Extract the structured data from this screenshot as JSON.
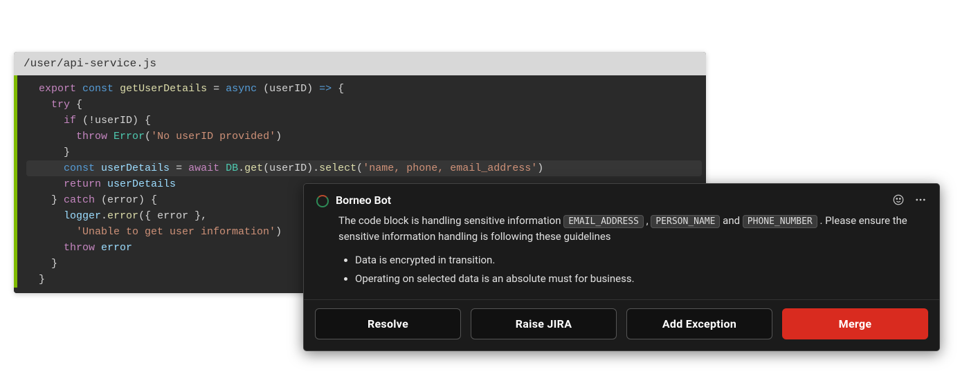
{
  "file_path": "/user/api-service.js",
  "code": {
    "l1": {
      "kw_export": "export",
      "kw_const": "const",
      "fn": "getUserDetails",
      "eq": " = ",
      "kw_async": "async",
      "params": " (userID) ",
      "arrow": "=>",
      "brace": " {"
    },
    "l2": {
      "kw_try": "try",
      "brace": " {"
    },
    "l3": {
      "kw_if": "if",
      "cond": " (!userID) {"
    },
    "l4": {
      "kw_throw": "throw",
      "cls": " Error",
      "open": "(",
      "str": "'No userID provided'",
      "close": ")"
    },
    "l5": {
      "brace": "}"
    },
    "l6": {
      "kw_const": "const",
      "ident": " userDetails",
      "eq": " = ",
      "kw_await": "await",
      "cls": " DB",
      "dot1": ".",
      "m1": "get",
      "p1": "(userID).",
      "m2": "select",
      "p2": "(",
      "str": "'name, phone, email_address'",
      "p3": ")"
    },
    "l7": {
      "kw_return": "return",
      "ident": " userDetails"
    },
    "l8": {
      "brace": "} ",
      "kw_catch": "catch",
      "params": " (error) {"
    },
    "l9": {
      "obj": "logger",
      "dot": ".",
      "m": "error",
      "args": "({ error },"
    },
    "l10": {
      "str": "'Unable to get user information'",
      "close": ")"
    },
    "l11": {
      "kw_throw": "throw",
      "ident": " error"
    },
    "l12": {
      "brace": "}"
    },
    "l13": {
      "brace": "}"
    }
  },
  "bot": {
    "name": "Borneo Bot",
    "msg_prefix": "The code block is handling sensitive information ",
    "chips": {
      "c1": "EMAIL_ADDRESS",
      "c2": "PERSON_NAME",
      "c3": "PHONE_NUMBER"
    },
    "sep_comma": " , ",
    "sep_and": " and ",
    "msg_suffix": " . Please ensure the sensitive information handling is following these guidelines",
    "bullets": {
      "b1": "Data is encrypted in transition.",
      "b2": "Operating on selected data is an absolute must for business."
    },
    "actions": {
      "resolve": "Resolve",
      "raise_jira": "Raise JIRA",
      "add_exception": "Add Exception",
      "merge": "Merge"
    }
  }
}
